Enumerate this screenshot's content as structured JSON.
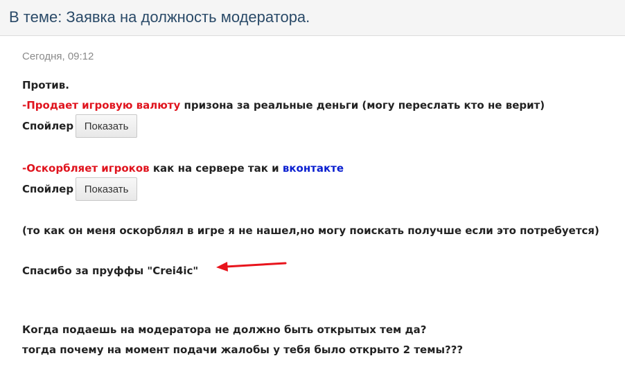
{
  "topic": {
    "title": "В теме: Заявка на должность модератора."
  },
  "post": {
    "date": "Сегодня, 09:12",
    "against": "Против.",
    "item1": {
      "dash": "-",
      "highlight": "Продает игровую валюту",
      "rest": " призона за реальные деньги (могу переслать кто не верит)"
    },
    "spoiler1": {
      "label": "Спойлер",
      "button": "Показать"
    },
    "item2": {
      "dash": "-",
      "highlight": "Оскорбляет игроков",
      "middle": " как на сервере так и ",
      "link": "вконтакте"
    },
    "spoiler2": {
      "label": "Спойлер",
      "button": "Показать"
    },
    "note": "(то как он меня оскорблял в игре я не нашел,но могу поискать получше если это потребуется)",
    "thanks": "Спасибо за пруффы \"Crei4ic\"",
    "question1": "Когда подаешь на модератора не должно быть открытых тем да?",
    "question2": "тогда почему на момент подачи жалобы у тебя было открыто 2 темы???"
  },
  "colors": {
    "title": "#2a4a68",
    "highlight_red": "#e0141e",
    "link_blue": "#0a1fd0",
    "arrow_red": "#e8141c"
  },
  "icons": {
    "arrow": "red-arrow-pointing-left"
  }
}
